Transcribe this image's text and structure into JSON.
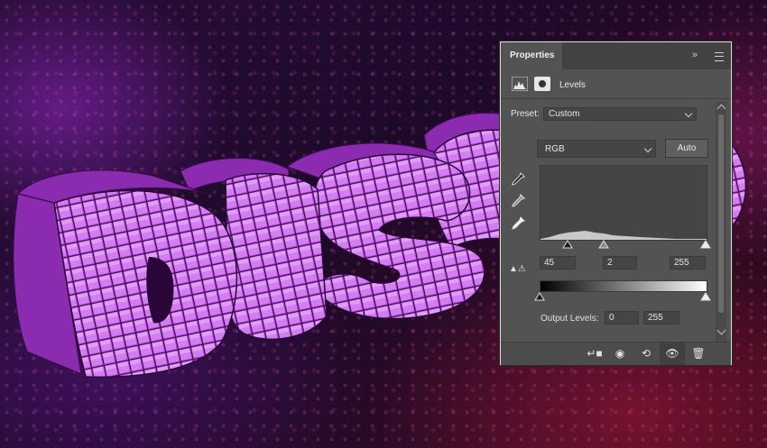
{
  "panel": {
    "tab_label": "Properties",
    "adjustment_label": "Levels",
    "preset_label": "Preset:",
    "preset_value": "Custom",
    "channel_value": "RGB",
    "auto_label": "Auto",
    "input_black": "45",
    "input_gamma": "2",
    "input_white": "255",
    "output_label": "Output Levels:",
    "output_black": "0",
    "output_white": "255"
  },
  "icons": {
    "collapse": "double-chevron-right-icon",
    "menu": "panel-menu-icon",
    "levels": "levels-histogram-icon",
    "mask": "layer-mask-icon",
    "eyedroppers": [
      "black-point-eyedropper-icon",
      "gray-point-eyedropper-icon",
      "white-point-eyedropper-icon"
    ],
    "clipping_warning": "clipping-warning-icon",
    "bottom": [
      "clip-to-layer-icon",
      "view-previous-state-icon",
      "reset-icon",
      "visibility-eye-icon",
      "trash-icon"
    ]
  },
  "colors": {
    "panel_bg": "#535353",
    "accent_purple": "#c63fe0"
  }
}
